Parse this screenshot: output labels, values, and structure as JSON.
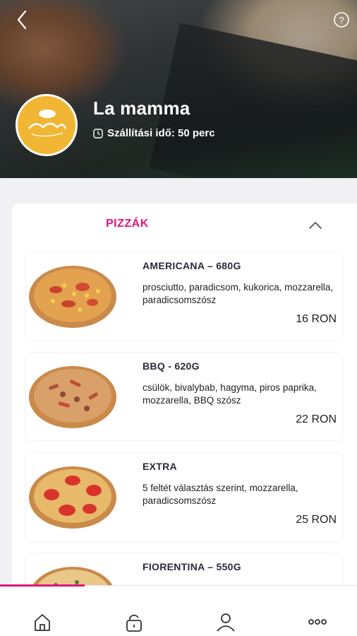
{
  "header": {
    "restaurant_name": "La mamma",
    "delivery_text": "Szállítási idő: 50 perc",
    "icons": {
      "back": "chevron-left-icon",
      "help": "question-circle-icon",
      "clock": "clock-icon",
      "logo": "restaurant-logo"
    }
  },
  "menu": {
    "category_title": "PIZZÁK",
    "items": [
      {
        "name": "AMERICANA – 680G",
        "desc": "prosciutto, paradicsom, kukorica, mozzarella, paradicsomszósz",
        "price": "16 RON"
      },
      {
        "name": "BBQ - 620G",
        "desc": "csülök, bivalybab, hagyma, piros paprika, mozzarella, BBQ szósz",
        "price": "22 RON"
      },
      {
        "name": "EXTRA",
        "desc": "5 feltét választás szerint, mozzarella, paradicsomszósz",
        "price": "25 RON"
      },
      {
        "name": "FIORENTINA – 550G",
        "desc": "",
        "price": ""
      }
    ]
  },
  "bottom_nav": {
    "icons": [
      "home-icon",
      "lock-icon",
      "user-icon",
      "more-icon"
    ],
    "accent_color": "#e0157f"
  },
  "colors": {
    "accent": "#e0157f",
    "logo_bg": "#f2b635"
  }
}
